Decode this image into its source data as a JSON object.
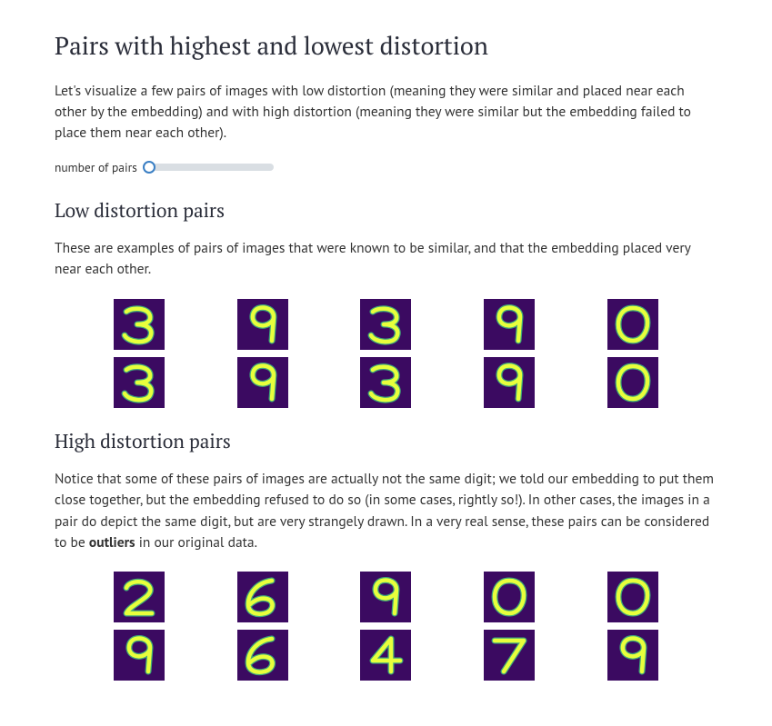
{
  "headings": {
    "main": "Pairs with highest and lowest distortion",
    "low": "Low distortion pairs",
    "high": "High distortion pairs"
  },
  "paragraphs": {
    "intro": "Let's visualize a few pairs of images with low distortion (meaning they were similar and placed near each other by the embedding) and with high distortion (meaning they were similar but the embedding failed to place them near each other).",
    "low": "These are examples of pairs of images that were known to be similar, and that the embedding placed very near each other.",
    "high_pre": "Notice that some of these pairs of images are actually not the same digit; we told our embedding to put them close together, but the embedding refused to do so (in some cases, rightly so!). In other cases, the images in a pair do depict the same digit, but are very strangely drawn. In a very real sense, these pairs can be considered to be ",
    "high_bold": "outliers",
    "high_post": " in our original data."
  },
  "slider": {
    "label": "number of pairs",
    "value": 0
  },
  "low_pairs": [
    {
      "top": "3",
      "bottom": "3"
    },
    {
      "top": "9",
      "bottom": "9"
    },
    {
      "top": "3",
      "bottom": "3"
    },
    {
      "top": "9",
      "bottom": "9"
    },
    {
      "top": "0",
      "bottom": "0"
    }
  ],
  "high_pairs": [
    {
      "top": "2",
      "bottom": "9"
    },
    {
      "top": "6",
      "bottom": "6"
    },
    {
      "top": "9",
      "bottom": "4"
    },
    {
      "top": "0",
      "bottom": "7"
    },
    {
      "top": "0",
      "bottom": "9"
    }
  ],
  "colors": {
    "digit_bg": "#3b0a61",
    "stroke_bright": "#e8ff3c",
    "stroke_dim": "#3fa87a"
  }
}
